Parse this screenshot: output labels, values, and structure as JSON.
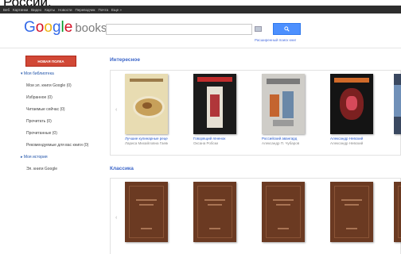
{
  "caption": "России.",
  "topbar": {
    "items": [
      "Веб",
      "Картинки",
      "Видео",
      "Карты",
      "Новости",
      "Переводчик",
      "Почта",
      "Еще »"
    ]
  },
  "logo": {
    "google": "Google",
    "books": "books"
  },
  "search": {
    "value": "",
    "placeholder": "",
    "advanced_link": "Расширенный поиск книг"
  },
  "sidebar": {
    "new_shelf_button": "НОВАЯ ПОЛКА",
    "items": [
      {
        "label": "▾ Моя библиотека",
        "kind": "head"
      },
      {
        "label": "Мои эл. книги Google (0)",
        "kind": "sub"
      },
      {
        "label": "Избранное (0)",
        "kind": "sub"
      },
      {
        "label": "Читаемые сейчас (0)",
        "kind": "sub"
      },
      {
        "label": "Прочитать (0)",
        "kind": "sub"
      },
      {
        "label": "Прочитанные (0)",
        "kind": "sub"
      },
      {
        "label": "Рекомендуемые для вас книги (0)",
        "kind": "sub"
      },
      {
        "label": "▸ Моя история",
        "kind": "head"
      },
      {
        "label": "Эл. книги Google",
        "kind": "sub"
      }
    ]
  },
  "shelves": [
    {
      "title": "Интересное",
      "books": [
        {
          "title": "Лучшие кулинарные рецепты",
          "author": "Лариса Михайловна Гаевская",
          "cover": "food-plate"
        },
        {
          "title": "Говорящий ягненок",
          "author": "Оксана Робски",
          "cover": "dark-figure"
        },
        {
          "title": "Российский авангард",
          "author": "Александр П. Чубаров",
          "cover": "avantgarde"
        },
        {
          "title": "Александр Невский",
          "author": "Александр Невский",
          "cover": "dark-portrait"
        },
        {
          "title": "",
          "author": "",
          "cover": "cut-off"
        }
      ]
    },
    {
      "title": "Классика",
      "books": [
        {
          "title": "",
          "author": "",
          "cover": "brown-classic"
        },
        {
          "title": "",
          "author": "",
          "cover": "brown-classic"
        },
        {
          "title": "",
          "author": "",
          "cover": "brown-classic"
        },
        {
          "title": "",
          "author": "",
          "cover": "brown-classic"
        },
        {
          "title": "",
          "author": "",
          "cover": "brown-classic"
        }
      ]
    }
  ],
  "colors": {
    "accent_blue": "#4d90fe",
    "new_shelf_red": "#d14836",
    "shelf_title": "#3a64c8",
    "topbar": "#2d2d2d"
  }
}
